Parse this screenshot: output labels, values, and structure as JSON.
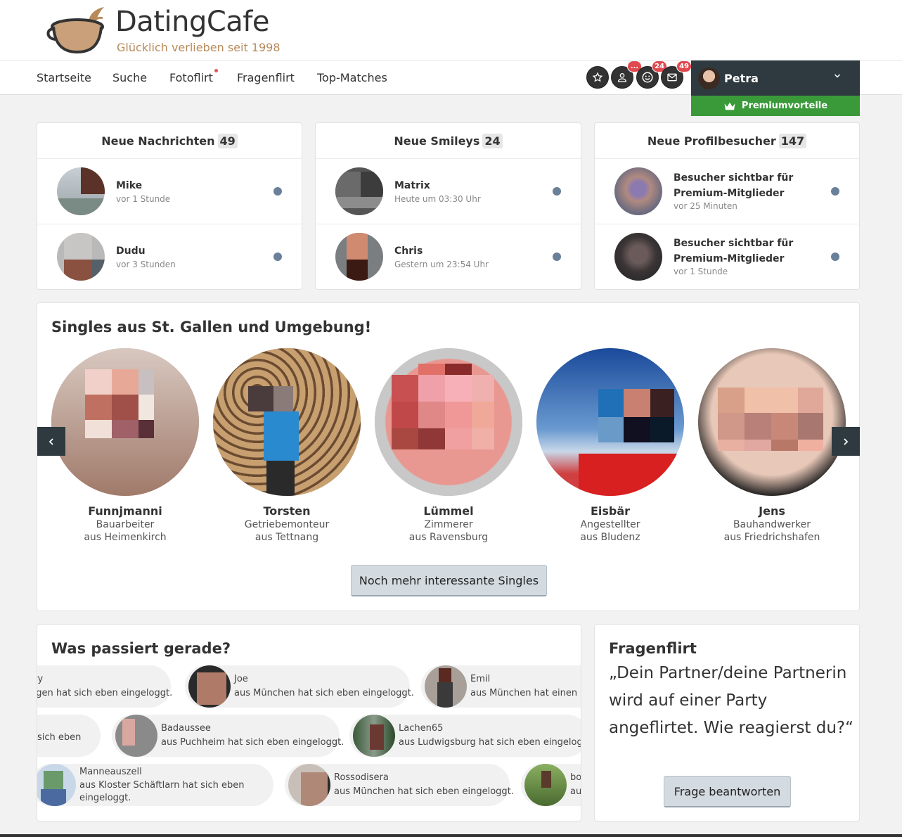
{
  "brand": {
    "name": "DatingCafe",
    "tagline": "Glücklich verlieben seit 1998"
  },
  "nav": {
    "items": [
      "Startseite",
      "Suche",
      "Fotoflirt",
      "Fragenflirt",
      "Top-Matches"
    ]
  },
  "header_icons": {
    "favorites": {
      "icon": "star-icon"
    },
    "visitors": {
      "icon": "user-icon",
      "badge": "..."
    },
    "smileys": {
      "icon": "smiley-icon",
      "badge": "24"
    },
    "messages": {
      "icon": "mail-icon",
      "badge": "49"
    }
  },
  "user": {
    "name": "Petra",
    "premium_label": "Premiumvorteile"
  },
  "messages_card": {
    "title": "Neue Nachrichten",
    "count": "49",
    "items": [
      {
        "name": "Mike",
        "time": "vor 1 Stunde"
      },
      {
        "name": "Dudu",
        "time": "vor 3 Stunden"
      }
    ]
  },
  "smileys_card": {
    "title": "Neue Smileys",
    "count": "24",
    "items": [
      {
        "name": "Matrix",
        "time": "Heute um 03:30 Uhr"
      },
      {
        "name": "Chris",
        "time": "Gestern um 23:54 Uhr"
      }
    ]
  },
  "visitors_card": {
    "title": "Neue Profilbesucher",
    "count": "147",
    "items": [
      {
        "name": "Besucher sichtbar für Premium-Mitglieder",
        "time": "vor 25 Minuten"
      },
      {
        "name": "Besucher sichtbar für Premium-Mitglieder",
        "time": "vor 1 Stunde"
      }
    ]
  },
  "singles": {
    "title": "Singles aus St. Gallen und Umgebung!",
    "items": [
      {
        "name": "Funnjmanni",
        "job": "Bauarbeiter",
        "location": "aus Heimenkirch"
      },
      {
        "name": "Torsten",
        "job": "Getriebemonteur",
        "location": "aus Tettnang"
      },
      {
        "name": "Lümmel",
        "job": "Zimmerer",
        "location": "aus Ravensburg"
      },
      {
        "name": "Eisbär",
        "job": "Angestellter",
        "location": "aus Bludenz"
      },
      {
        "name": "Jens",
        "job": "Bauhandwerker",
        "location": "aus Friedrichshafen"
      }
    ],
    "more_button": "Noch mehr interessante Singles"
  },
  "activity": {
    "title": "Was passiert gerade?",
    "items": [
      {
        "name": "rry",
        "text": "ngen hat sich eben eingeloggt."
      },
      {
        "name": "Joe",
        "text": "aus München hat sich eben eingeloggt."
      },
      {
        "name": "Emil",
        "text": "aus München hat einen S"
      },
      {
        "name": "",
        "text": "sich eben"
      },
      {
        "name": "Badaussee",
        "text": "aus Puchheim hat sich eben eingeloggt."
      },
      {
        "name": "Lachen65",
        "text": "aus Ludwigsburg hat sich eben eingeloggt."
      },
      {
        "name": "Manneauszell",
        "text": "aus Kloster Schäftlarn hat sich eben",
        "text2": "eingeloggt."
      },
      {
        "name": "Rossodisera",
        "text": "aus München hat sich eben eingeloggt."
      },
      {
        "name": "bo",
        "text": "au"
      }
    ]
  },
  "fragenflirt": {
    "title": "Fragenflirt",
    "question": "„Dein Partner/deine Partnerin wird auf einer Party angeflirtet. Wie reagierst du?“",
    "button": "Frage beantworten"
  }
}
